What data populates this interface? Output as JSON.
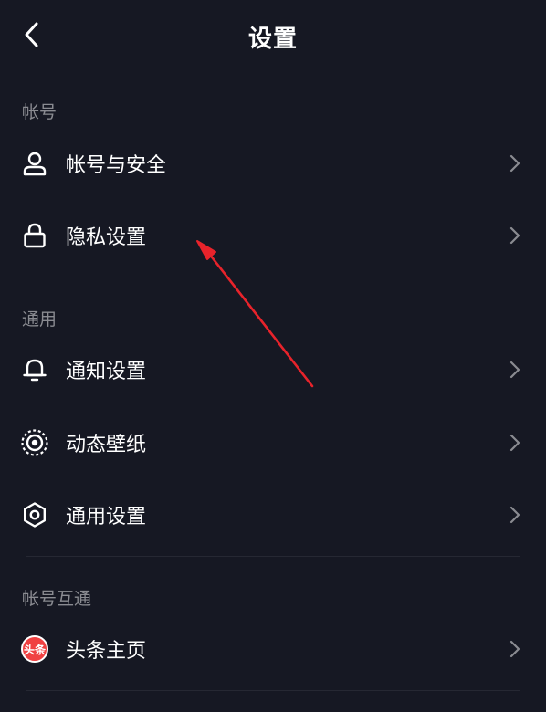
{
  "header": {
    "title": "设置"
  },
  "sections": [
    {
      "label": "帐号",
      "items": [
        {
          "label": "帐号与安全",
          "icon": "user-icon"
        },
        {
          "label": "隐私设置",
          "icon": "lock-icon"
        }
      ]
    },
    {
      "label": "通用",
      "items": [
        {
          "label": "通知设置",
          "icon": "bell-icon"
        },
        {
          "label": "动态壁纸",
          "icon": "live-wallpaper-icon"
        },
        {
          "label": "通用设置",
          "icon": "gear-icon"
        }
      ]
    },
    {
      "label": "帐号互通",
      "items": [
        {
          "label": "头条主页",
          "icon": "toutiao-logo-icon",
          "logo_text": "头条"
        }
      ]
    }
  ],
  "colors": {
    "background": "#161823",
    "section_label": "#8a8b91",
    "text": "#ffffff",
    "chevron": "#8a8b91",
    "annotation_arrow": "#e8232b"
  }
}
